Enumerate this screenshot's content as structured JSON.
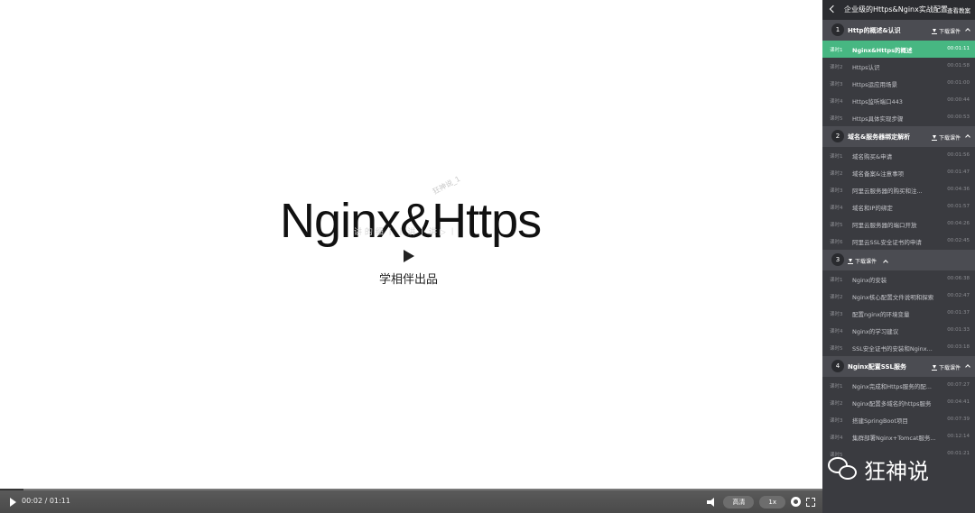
{
  "stage": {
    "slide_title": "Nginx&Https",
    "watermark_small": "狂神说_1",
    "subtitle_line": "讲 的 细 丨 丨 讲 丨 讲 ▷ 丨",
    "producer": "学相伴出品"
  },
  "controls": {
    "time": "00:02 / 01:11",
    "progress_fraction": 0.028,
    "quality_label": "高清",
    "speed_label": "1x"
  },
  "sidebar": {
    "title": "企业级的Https&Nginx实战配置",
    "action": "查看教案",
    "download_label": "下载课件",
    "chapters": [
      {
        "num": "1",
        "title": "Http的概述&认识",
        "lessons": [
          {
            "num": "课时1",
            "title": "Nginx&Https的概述",
            "dur": "00:01:11",
            "active": true
          },
          {
            "num": "课时2",
            "title": "Https认识",
            "dur": "00:01:58"
          },
          {
            "num": "课时3",
            "title": "Https运应用场景",
            "dur": "00:01:00"
          },
          {
            "num": "课时4",
            "title": "Https监听端口443",
            "dur": "00:00:44"
          },
          {
            "num": "课时5",
            "title": "Https具体实现步骤",
            "dur": "00:00:53"
          }
        ]
      },
      {
        "num": "2",
        "title": "域名&服务器绑定解析",
        "lessons": [
          {
            "num": "课时1",
            "title": "域名购买&申请",
            "dur": "00:01:56"
          },
          {
            "num": "课时2",
            "title": "域名备案&注意事项",
            "dur": "00:01:47"
          },
          {
            "num": "课时3",
            "title": "阿里云服务器的购买和注...",
            "dur": "00:04:36"
          },
          {
            "num": "课时4",
            "title": "域名和IP的绑定",
            "dur": "00:01:57"
          },
          {
            "num": "课时5",
            "title": "阿里云服务器的端口开放",
            "dur": "00:04:26"
          },
          {
            "num": "课时6",
            "title": "阿里云SSL安全证书的申请",
            "dur": "00:02:45"
          }
        ]
      },
      {
        "num": "3",
        "title": "",
        "lessons": [
          {
            "num": "课时1",
            "title": "Nginx的安装",
            "dur": "00:06:38"
          },
          {
            "num": "课时2",
            "title": "Nginx核心配置文件说明和探索",
            "dur": "00:02:47"
          },
          {
            "num": "课时3",
            "title": "配置nginx的环境变量",
            "dur": "00:01:37"
          },
          {
            "num": "课时4",
            "title": "Nginx的学习建议",
            "dur": "00:01:33"
          },
          {
            "num": "课时5",
            "title": "SSL安全证书的安装和Nginx...",
            "dur": "00:03:18"
          }
        ]
      },
      {
        "num": "4",
        "title": "Nginx配置SSL服务",
        "lessons": [
          {
            "num": "课时1",
            "title": "Nginx完成和Https服务的配...",
            "dur": "00:07:27"
          },
          {
            "num": "课时2",
            "title": "Nginx配置多域名的https服务",
            "dur": "00:04:41"
          },
          {
            "num": "课时3",
            "title": "搭建SpringBoot项目",
            "dur": "00:07:39"
          },
          {
            "num": "课时4",
            "title": "集群部署Nginx+Tomcat服务...",
            "dur": "00:12:14"
          },
          {
            "num": "课时5",
            "title": "",
            "dur": "00:01:21"
          }
        ]
      }
    ]
  },
  "watermark": {
    "text": "狂神说"
  }
}
